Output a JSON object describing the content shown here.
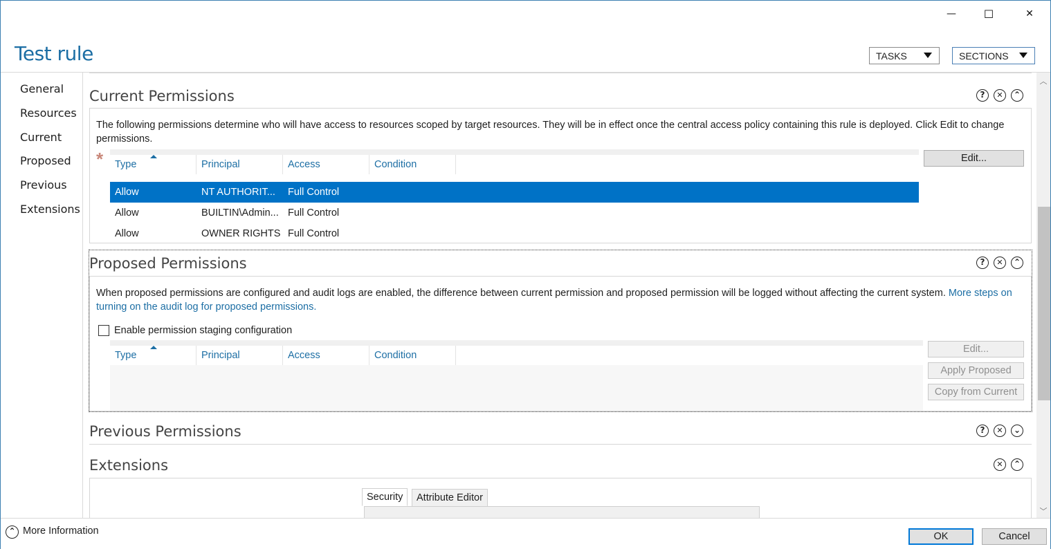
{
  "window": {
    "minimize_glyph": "—",
    "maximize_glyph": "☐",
    "close_glyph": "✕"
  },
  "header": {
    "title": "Test rule",
    "tasks_label": "TASKS",
    "sections_label": "SECTIONS"
  },
  "nav": {
    "items": [
      {
        "label": "General"
      },
      {
        "label": "Resources"
      },
      {
        "label": "Current"
      },
      {
        "label": "Proposed"
      },
      {
        "label": "Previous"
      },
      {
        "label": "Extensions"
      }
    ]
  },
  "current_permissions": {
    "title": "Current Permissions",
    "description": "The following permissions determine who will have access to resources scoped by target resources. They will be in effect once the central access policy containing this rule is deployed. Click Edit to change permissions.",
    "required_marker": "*",
    "columns": [
      "Type",
      "Principal",
      "Access",
      "Condition"
    ],
    "rows": [
      {
        "type": "Allow",
        "principal": "NT AUTHORIT...",
        "access": "Full Control",
        "selected": true
      },
      {
        "type": "Allow",
        "principal": "BUILTIN\\Admin...",
        "access": "Full Control",
        "selected": false
      },
      {
        "type": "Allow",
        "principal": "OWNER RIGHTS",
        "access": "Full Control",
        "selected": false
      }
    ],
    "edit_label": "Edit..."
  },
  "proposed_permissions": {
    "title": "Proposed Permissions",
    "description": "When proposed permissions are configured and audit logs are enabled, the difference between current permission and proposed permission will be logged without affecting the current system.",
    "link_text": "More steps on turning on the audit log for proposed permissions.",
    "checkbox_label": "Enable permission staging configuration",
    "checkbox_checked": false,
    "columns": [
      "Type",
      "Principal",
      "Access",
      "Condition"
    ],
    "edit_label": "Edit...",
    "apply_label": "Apply Proposed",
    "copy_label": "Copy from Current"
  },
  "previous_permissions": {
    "title": "Previous Permissions"
  },
  "extensions": {
    "title": "Extensions",
    "tabs": [
      "Security",
      "Attribute Editor"
    ]
  },
  "section_icons": {
    "help": "?",
    "close": "✕",
    "collapse": "⌃",
    "expand": "⌄"
  },
  "footer": {
    "more_info_label": "More Information",
    "ok_label": "OK",
    "cancel_label": "Cancel"
  },
  "colors": {
    "accent": "#1c6ea4",
    "selection": "#0072c6",
    "required": "#c9887a"
  }
}
